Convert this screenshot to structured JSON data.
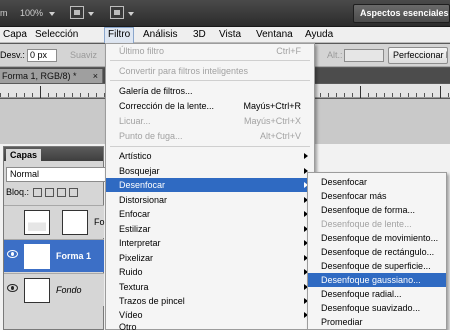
{
  "app": {
    "zoom": "100%",
    "workspace": "Aspectos esenciales"
  },
  "menubar": {
    "items": [
      "Capa",
      "Selección",
      "Filtro",
      "Análisis",
      "3D",
      "Vista",
      "Ventana",
      "Ayuda"
    ],
    "active": "Filtro"
  },
  "options": {
    "feather_label": "Desv.:",
    "feather_value": "0 px",
    "antialias": "Suaviz",
    "width_label": "Alt.:",
    "refine_button": "Perfeccionar b"
  },
  "document": {
    "tab": "Forma 1, RGB/8) *",
    "close": "×"
  },
  "layers_panel": {
    "tab": "Capas",
    "blend_mode": "Normal",
    "lock_label": "Bloq.:",
    "layers": [
      {
        "name": "Fo",
        "selected": false,
        "italic": false
      },
      {
        "name": "Forma 1",
        "selected": true,
        "italic": false
      },
      {
        "name": "Fondo",
        "selected": false,
        "italic": true
      }
    ]
  },
  "filter_menu": {
    "items": [
      {
        "label": "Último filtro",
        "shortcut": "Ctrl+F",
        "disabled": true
      },
      {
        "label": "Convertir para filtros inteligentes",
        "disabled": true
      },
      {
        "label": "Galería de filtros...",
        "disabled": false
      },
      {
        "label": "Corrección de la lente...",
        "shortcut": "Mayús+Ctrl+R",
        "disabled": false
      },
      {
        "label": "Licuar...",
        "shortcut": "Mayús+Ctrl+X",
        "disabled": true
      },
      {
        "label": "Punto de fuga...",
        "shortcut": "Alt+Ctrl+V",
        "disabled": true
      },
      {
        "label": "Artístico",
        "submenu": true
      },
      {
        "label": "Bosquejar",
        "submenu": true
      },
      {
        "label": "Desenfocar",
        "submenu": true,
        "highlighted": true
      },
      {
        "label": "Distorsionar",
        "submenu": true
      },
      {
        "label": "Enfocar",
        "submenu": true
      },
      {
        "label": "Estilizar",
        "submenu": true
      },
      {
        "label": "Interpretar",
        "submenu": true
      },
      {
        "label": "Pixelizar",
        "submenu": true
      },
      {
        "label": "Ruido",
        "submenu": true
      },
      {
        "label": "Textura",
        "submenu": true
      },
      {
        "label": "Trazos de pincel",
        "submenu": true
      },
      {
        "label": "Vídeo",
        "submenu": true
      },
      {
        "label": "Otro",
        "submenu": true
      }
    ]
  },
  "blur_submenu": {
    "items": [
      {
        "label": "Desenfocar",
        "disabled": false
      },
      {
        "label": "Desenfocar más",
        "disabled": false
      },
      {
        "label": "Desenfoque de forma...",
        "disabled": false
      },
      {
        "label": "Desenfoque de lente...",
        "disabled": true
      },
      {
        "label": "Desenfoque de movimiento...",
        "disabled": false
      },
      {
        "label": "Desenfoque de rectángulo...",
        "disabled": false
      },
      {
        "label": "Desenfoque de superficie...",
        "disabled": false
      },
      {
        "label": "Desenfoque gaussiano...",
        "disabled": false,
        "highlighted": true
      },
      {
        "label": "Desenfoque radial...",
        "disabled": false
      },
      {
        "label": "Desenfoque suavizado...",
        "disabled": false
      },
      {
        "label": "Promediar",
        "disabled": false
      }
    ]
  }
}
